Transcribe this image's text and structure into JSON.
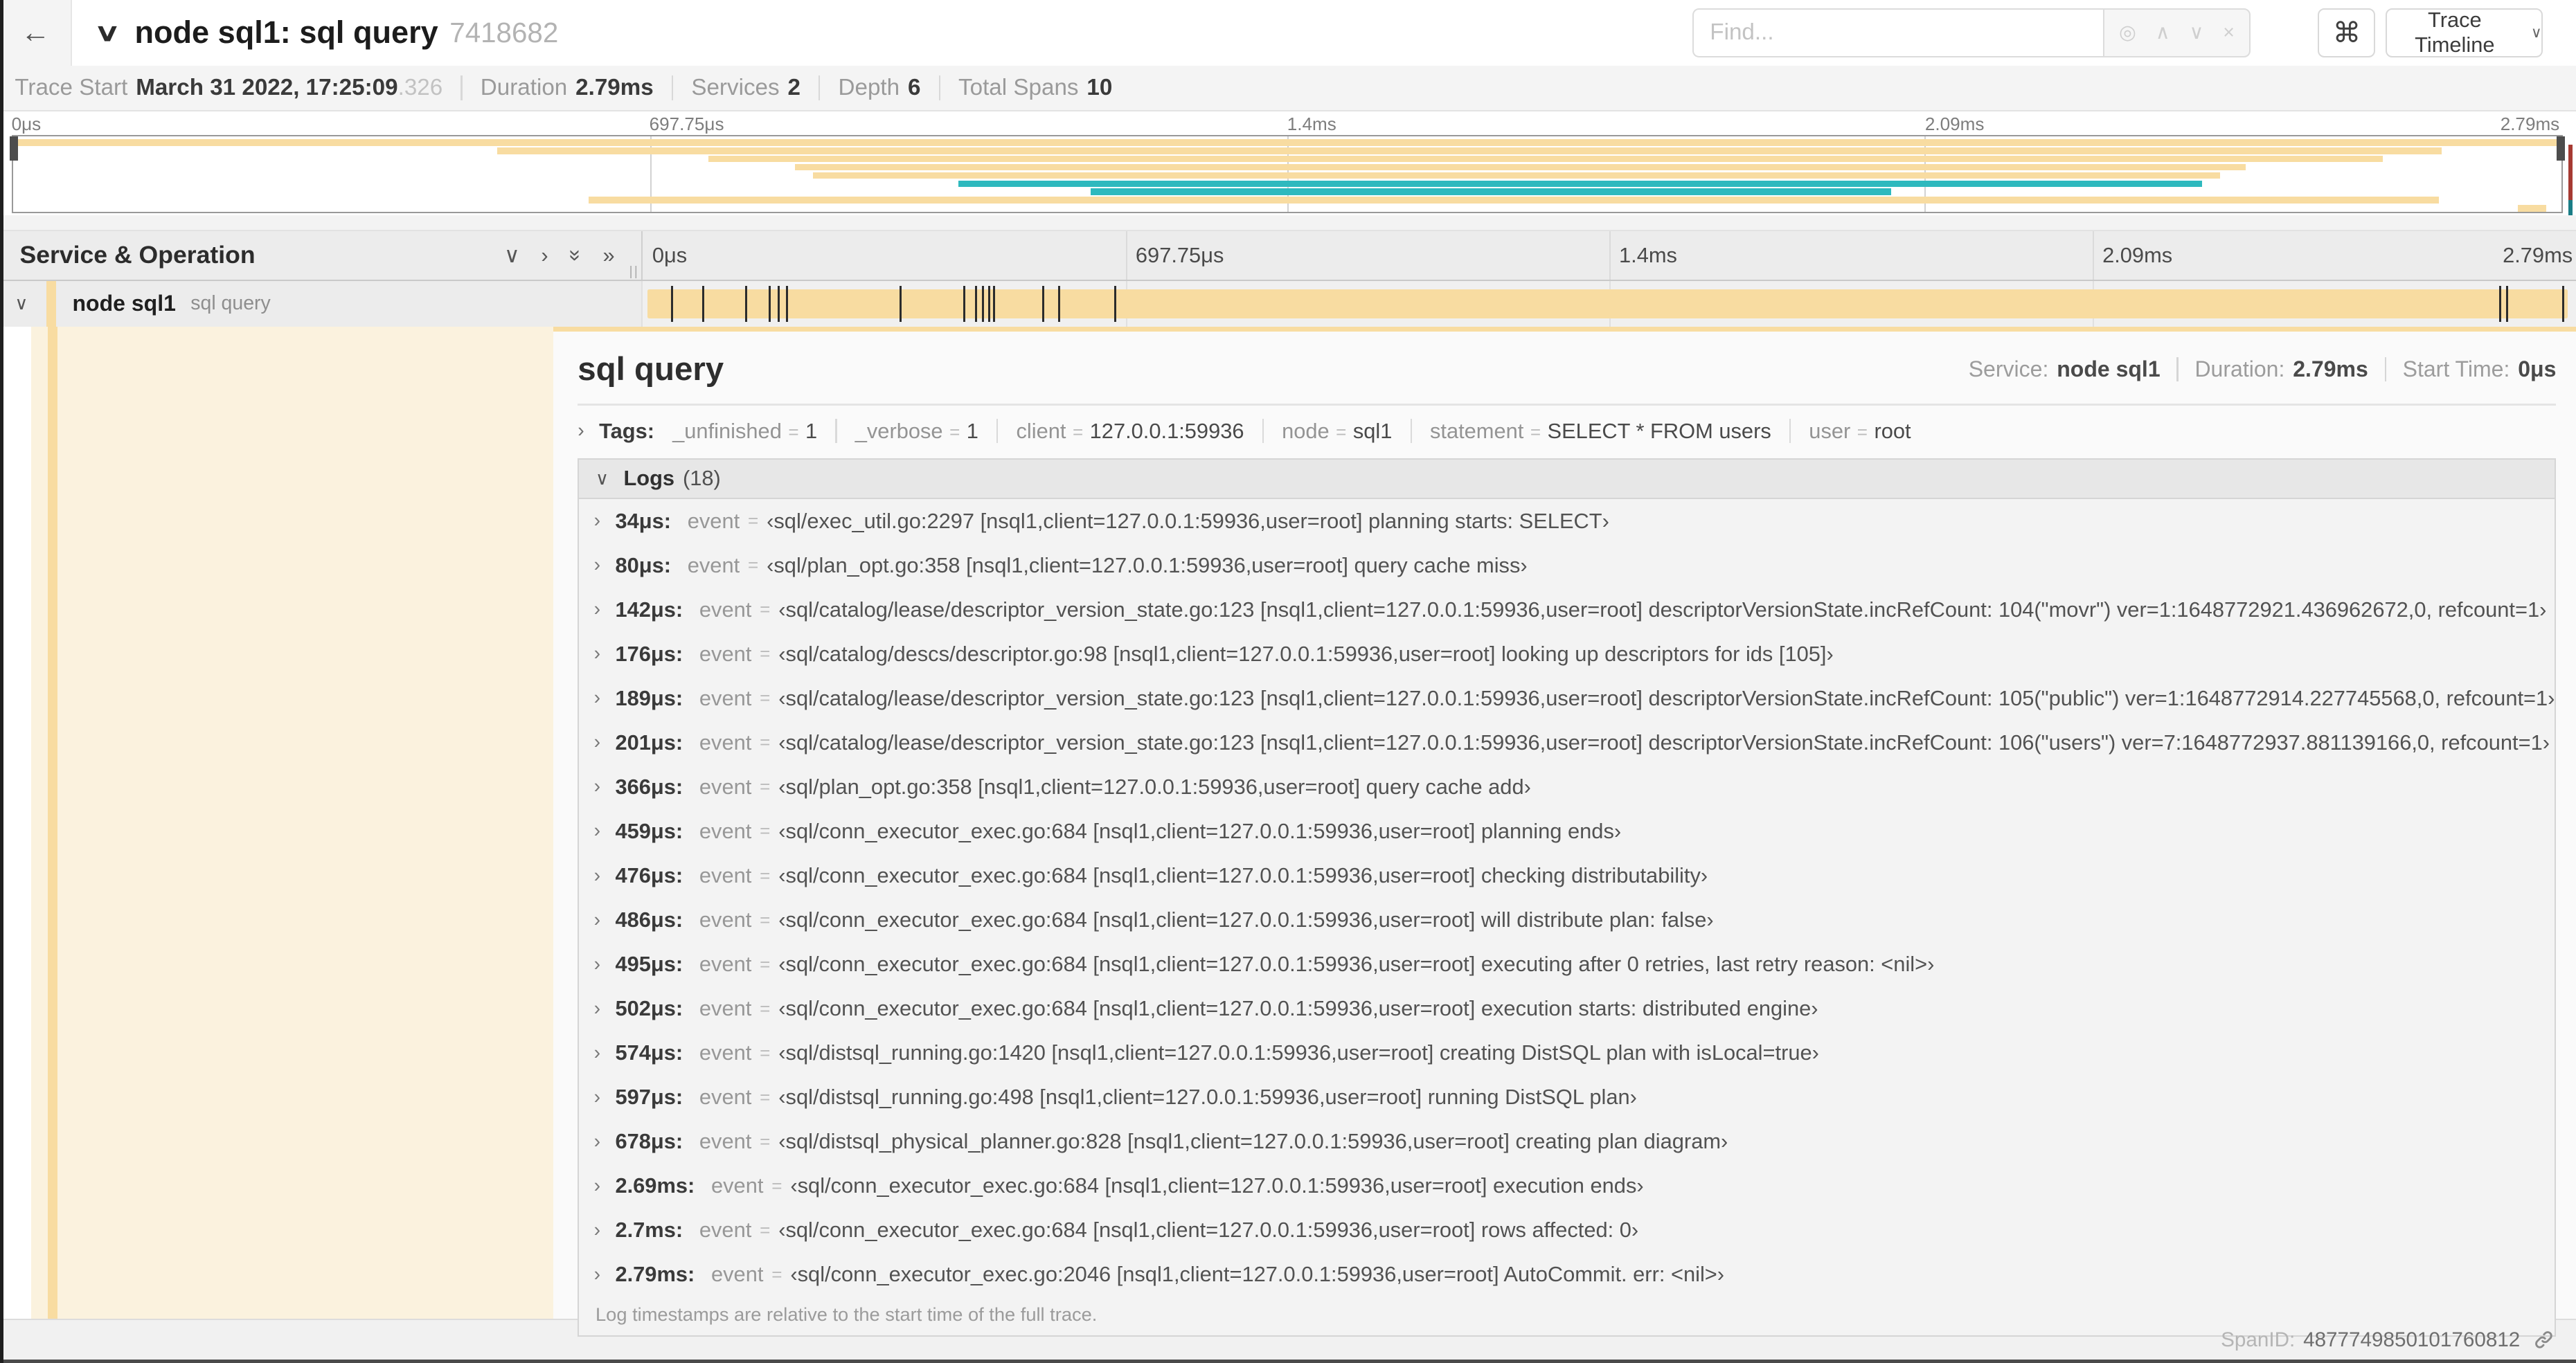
{
  "icons": {
    "back": "←",
    "chevron_down": "∨",
    "chevron_right": "›",
    "double_chevron": "»",
    "locate": "◎",
    "prev": "∧",
    "next": "∨",
    "clear": "×",
    "shortcuts": "⌘",
    "grip": "||",
    "dropdown_caret": "∨"
  },
  "header": {
    "title": "node sql1: sql query",
    "trace_id": "7418682",
    "find_placeholder": "Find...",
    "view_dropdown_label": "Trace Timeline"
  },
  "summary": {
    "items": [
      {
        "label": "Trace Start",
        "value": "March 31 2022, 17:25:09",
        "suffix": ".326"
      },
      {
        "label": "Duration",
        "value": "2.79ms",
        "suffix": ""
      },
      {
        "label": "Services",
        "value": "2",
        "suffix": ""
      },
      {
        "label": "Depth",
        "value": "6",
        "suffix": ""
      },
      {
        "label": "Total Spans",
        "value": "10",
        "suffix": ""
      }
    ]
  },
  "minimap": {
    "ticks": [
      "0μs",
      "697.75μs",
      "1.4ms",
      "2.09ms",
      "2.79ms"
    ],
    "colors": {
      "wheat": "#F8DCA1",
      "teal": "#2EB9BE"
    },
    "spans": [
      {
        "start": 0,
        "end": 100,
        "color": "wheat"
      },
      {
        "start": 19,
        "end": 95.3,
        "color": "wheat"
      },
      {
        "start": 27.3,
        "end": 93,
        "color": "wheat"
      },
      {
        "start": 30.7,
        "end": 87.6,
        "color": "wheat"
      },
      {
        "start": 31.4,
        "end": 86.6,
        "color": "wheat"
      },
      {
        "start": 37.1,
        "end": 85.9,
        "color": "teal"
      },
      {
        "start": 42.3,
        "end": 73.7,
        "color": "teal"
      },
      {
        "start": 22.6,
        "end": 95.2,
        "color": "wheat"
      },
      {
        "start": 98.3,
        "end": 99.4,
        "color": "wheat"
      }
    ]
  },
  "timeline_header": {
    "left_title": "Service & Operation",
    "ticks": [
      "0μs",
      "697.75μs",
      "1.4ms",
      "2.09ms",
      "2.79ms"
    ]
  },
  "span_row": {
    "service": "node sql1",
    "operation": "sql query",
    "duration_us": 2790,
    "tick_times_us": [
      34,
      80,
      142,
      176,
      189,
      201,
      366,
      459,
      476,
      486,
      495,
      502,
      574,
      597,
      678,
      2690,
      2700,
      2790
    ]
  },
  "detail": {
    "title": "sql query",
    "meta": [
      {
        "label": "Service:",
        "value": "node sql1"
      },
      {
        "label": "Duration:",
        "value": "2.79ms"
      },
      {
        "label": "Start Time:",
        "value": "0μs"
      }
    ],
    "tags": {
      "label": "Tags:",
      "items": [
        {
          "key": "_unfinished",
          "value": "1"
        },
        {
          "key": "_verbose",
          "value": "1"
        },
        {
          "key": "client",
          "value": "127.0.0.1:59936"
        },
        {
          "key": "node",
          "value": "sql1"
        },
        {
          "key": "statement",
          "value": "SELECT * FROM users"
        },
        {
          "key": "user",
          "value": "root"
        }
      ]
    },
    "logs": {
      "label": "Logs",
      "count": "(18)",
      "footnote": "Log timestamps are relative to the start time of the full trace.",
      "entries": [
        {
          "time": "34μs:",
          "key": "event",
          "value": "‹sql/exec_util.go:2297 [nsql1,client=127.0.0.1:59936,user=root] planning starts: SELECT›"
        },
        {
          "time": "80μs:",
          "key": "event",
          "value": "‹sql/plan_opt.go:358 [nsql1,client=127.0.0.1:59936,user=root] query cache miss›"
        },
        {
          "time": "142μs:",
          "key": "event",
          "value": "‹sql/catalog/lease/descriptor_version_state.go:123 [nsql1,client=127.0.0.1:59936,user=root] descriptorVersionState.incRefCount: 104(\"movr\") ver=1:1648772921.436962672,0, refcount=1›"
        },
        {
          "time": "176μs:",
          "key": "event",
          "value": "‹sql/catalog/descs/descriptor.go:98 [nsql1,client=127.0.0.1:59936,user=root] looking up descriptors for ids [105]›"
        },
        {
          "time": "189μs:",
          "key": "event",
          "value": "‹sql/catalog/lease/descriptor_version_state.go:123 [nsql1,client=127.0.0.1:59936,user=root] descriptorVersionState.incRefCount: 105(\"public\") ver=1:1648772914.227745568,0, refcount=1›"
        },
        {
          "time": "201μs:",
          "key": "event",
          "value": "‹sql/catalog/lease/descriptor_version_state.go:123 [nsql1,client=127.0.0.1:59936,user=root] descriptorVersionState.incRefCount: 106(\"users\") ver=7:1648772937.881139166,0, refcount=1›"
        },
        {
          "time": "366μs:",
          "key": "event",
          "value": "‹sql/plan_opt.go:358 [nsql1,client=127.0.0.1:59936,user=root] query cache add›"
        },
        {
          "time": "459μs:",
          "key": "event",
          "value": "‹sql/conn_executor_exec.go:684 [nsql1,client=127.0.0.1:59936,user=root] planning ends›"
        },
        {
          "time": "476μs:",
          "key": "event",
          "value": "‹sql/conn_executor_exec.go:684 [nsql1,client=127.0.0.1:59936,user=root] checking distributability›"
        },
        {
          "time": "486μs:",
          "key": "event",
          "value": "‹sql/conn_executor_exec.go:684 [nsql1,client=127.0.0.1:59936,user=root] will distribute plan: false›"
        },
        {
          "time": "495μs:",
          "key": "event",
          "value": "‹sql/conn_executor_exec.go:684 [nsql1,client=127.0.0.1:59936,user=root] executing after 0 retries, last retry reason: <nil>›"
        },
        {
          "time": "502μs:",
          "key": "event",
          "value": "‹sql/conn_executor_exec.go:684 [nsql1,client=127.0.0.1:59936,user=root] execution starts: distributed engine›"
        },
        {
          "time": "574μs:",
          "key": "event",
          "value": "‹sql/distsql_running.go:1420 [nsql1,client=127.0.0.1:59936,user=root] creating DistSQL plan with isLocal=true›"
        },
        {
          "time": "597μs:",
          "key": "event",
          "value": "‹sql/distsql_running.go:498 [nsql1,client=127.0.0.1:59936,user=root] running DistSQL plan›"
        },
        {
          "time": "678μs:",
          "key": "event",
          "value": "‹sql/distsql_physical_planner.go:828 [nsql1,client=127.0.0.1:59936,user=root] creating plan diagram›"
        },
        {
          "time": "2.69ms:",
          "key": "event",
          "value": "‹sql/conn_executor_exec.go:684 [nsql1,client=127.0.0.1:59936,user=root] execution ends›"
        },
        {
          "time": "2.7ms:",
          "key": "event",
          "value": "‹sql/conn_executor_exec.go:684 [nsql1,client=127.0.0.1:59936,user=root] rows affected: 0›"
        },
        {
          "time": "2.79ms:",
          "key": "event",
          "value": "‹sql/conn_executor_exec.go:2046 [nsql1,client=127.0.0.1:59936,user=root] AutoCommit. err: <nil>›"
        }
      ]
    },
    "span_id_label": "SpanID:",
    "span_id": "4877749850101760812"
  }
}
